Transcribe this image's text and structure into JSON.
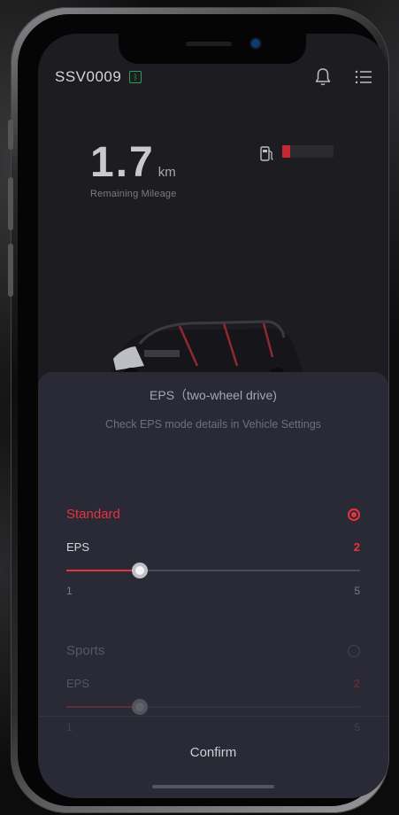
{
  "header": {
    "vehicle_id": "SSV0009",
    "connection_icon": "bluetooth-icon",
    "notification_icon": "bell-icon",
    "menu_icon": "list-menu-icon"
  },
  "dashboard": {
    "mileage_value": "1.7",
    "mileage_unit": "km",
    "mileage_label": "Remaining Mileage",
    "fuel_icon": "fuel-pump-icon",
    "fuel_level_percent": 15
  },
  "sheet": {
    "title": "EPS（two-wheel drive)",
    "subtitle": "Check EPS mode details in Vehicle Settings",
    "modes": [
      {
        "name": "Standard",
        "selected": true,
        "eps_label": "EPS",
        "eps_value": "2",
        "min_label": "1",
        "max_label": "5",
        "min": 1,
        "max": 5,
        "value": 2
      },
      {
        "name": "Sports",
        "selected": false,
        "eps_label": "EPS",
        "eps_value": "2",
        "min_label": "1",
        "max_label": "5",
        "min": 1,
        "max": 5,
        "value": 2
      }
    ],
    "confirm_label": "Confirm"
  },
  "colors": {
    "accent": "#e8323f",
    "sheet_bg": "#2a2a36",
    "text_primary": "#d4d4da",
    "text_muted": "#6f6f7d"
  }
}
